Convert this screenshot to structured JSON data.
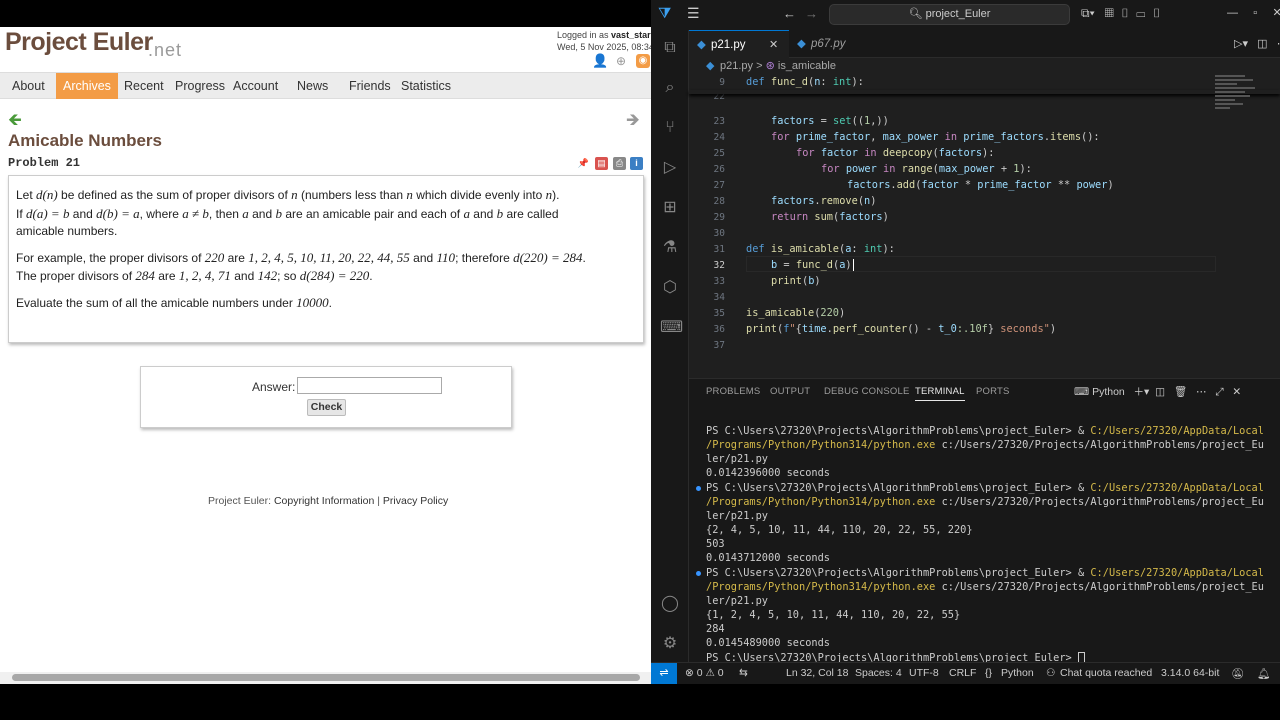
{
  "browser": {
    "logo": "Project Euler",
    "logo_suffix": ".net",
    "login_line1_prefix": "Logged in as ",
    "login_user": "vast_stars",
    "login_line2": "Wed, 5 Nov 2025, 08:34",
    "nav": [
      "About",
      "Archives",
      "Recent",
      "Progress",
      "Account",
      "News",
      "Friends",
      "Statistics"
    ],
    "active_nav": "Archives",
    "title": "Amicable Numbers",
    "problem": "Problem 21",
    "para1_line1_a": "Let ",
    "para1_dn": "d(n)",
    "para1_line1_b": " be defined as the sum of proper divisors of ",
    "para1_n": "n",
    "para1_line1_c": " (numbers less than ",
    "para1_line1_d": " which divide evenly into ",
    "para1_line1_e": ").",
    "para1_line2_a": "If ",
    "para1_da": "d(a) = b",
    "para1_and": " and ",
    "para1_db": "d(b) = a",
    "para1_line2_b": ", where ",
    "para1_aneb": "a ≠ b",
    "para1_line2_c": ", then ",
    "para1_a": "a",
    "para1_b": "b",
    "para1_line2_d": " are an amicable pair and each of ",
    "para1_line2_e": " are called",
    "para1_line3": "amicable numbers.",
    "para2_a": "For example, the proper divisors of ",
    "para2_220": "220",
    "para2_b": " are ",
    "para2_list1": "1, 2, 4, 5, 10, 11, 20, 22, 44, 55",
    "para2_c": " and ",
    "para2_110": "110",
    "para2_d": "; therefore ",
    "para2_d220": "d(220) = 284",
    "para2_e": ".",
    "para2_f": "The proper divisors of ",
    "para2_284": "284",
    "para2_list2": "1, 2, 4, 71",
    "para2_142": "142",
    "para2_g": "; so ",
    "para2_d284": "d(284) = 220",
    "para3_a": "Evaluate the sum of all the amicable numbers under ",
    "para3_n": "10000",
    "answer_label": "Answer:",
    "answer_value": "",
    "check_label": "Check",
    "footer_prefix": "Project Euler: ",
    "footer_link1": "Copyright Information",
    "footer_sep": " | ",
    "footer_link2": "Privacy Policy"
  },
  "vscode": {
    "search": "project_Euler",
    "tabs": [
      {
        "label": "p21.py",
        "active": true
      },
      {
        "label": "p67.py",
        "active": false
      }
    ],
    "breadcrumb_file": "p21.py",
    "breadcrumb_sep": ">",
    "breadcrumb_symbol": "is_amicable",
    "sticky_line": "9",
    "partial_line": "22",
    "code_lines": [
      {
        "n": "23",
        "text": "factors = set((1,))"
      },
      {
        "n": "24",
        "text": "for prime_factor, max_power in prime_factors.items():"
      },
      {
        "n": "25",
        "text": "for factor in deepcopy(factors):"
      },
      {
        "n": "26",
        "text": "for power in range(max_power + 1):"
      },
      {
        "n": "27",
        "text": "factors.add(factor * prime_factor ** power)"
      },
      {
        "n": "28",
        "text": "factors.remove(n)"
      },
      {
        "n": "29",
        "text": "return sum(factors)"
      },
      {
        "n": "30",
        "text": ""
      },
      {
        "n": "31",
        "text": "def is_amicable(a: int):"
      },
      {
        "n": "32",
        "text": "b = func_d(a)"
      },
      {
        "n": "33",
        "text": "print(b)"
      },
      {
        "n": "34",
        "text": ""
      },
      {
        "n": "35",
        "text": "is_amicable(220)"
      },
      {
        "n": "36",
        "text": "print(f\"{time.perf_counter() - t_0:.10f} seconds\")"
      },
      {
        "n": "37",
        "text": ""
      }
    ],
    "sticky_code": "def func_d(n: int):",
    "panel_tabs": [
      "PROBLEMS",
      "OUTPUT",
      "DEBUG CONSOLE",
      "TERMINAL",
      "PORTS"
    ],
    "active_panel_tab": "TERMINAL",
    "terminal_profile": "Python",
    "terminal": {
      "prompt": "PS C:\\Users\\27320\\Projects\\AlgorithmProblems\\project_Euler> & ",
      "exe_a": "C:/Users/27320/AppData/Local",
      "exe_b": "/Programs/Python/Python314/python.exe",
      "arg_a": " c:/Users/27320/Projects/AlgorithmProblems/project_Eu",
      "arg_b": "ler/p21.py",
      "run1_out": [
        "0.0142396000 seconds"
      ],
      "run2_out": [
        "{2, 4, 5, 10, 11, 44, 110, 20, 22, 55, 220}",
        "503",
        "0.0143712000 seconds"
      ],
      "run3_out": [
        "{1, 2, 4, 5, 10, 11, 44, 110, 20, 22, 55}",
        "284",
        "0.0145489000 seconds"
      ],
      "final_prompt": "PS C:\\Users\\27320\\Projects\\AlgorithmProblems\\project_Euler> "
    },
    "status": {
      "problems": "⊗ 0 ⚠ 0",
      "position": "Ln 32, Col 18",
      "spaces": "Spaces: 4",
      "encoding": "UTF-8",
      "eol": "CRLF",
      "language": "Python",
      "chat": "Chat quota reached",
      "interpreter": "3.14.0 64-bit"
    },
    "accent": "#0078d4"
  }
}
